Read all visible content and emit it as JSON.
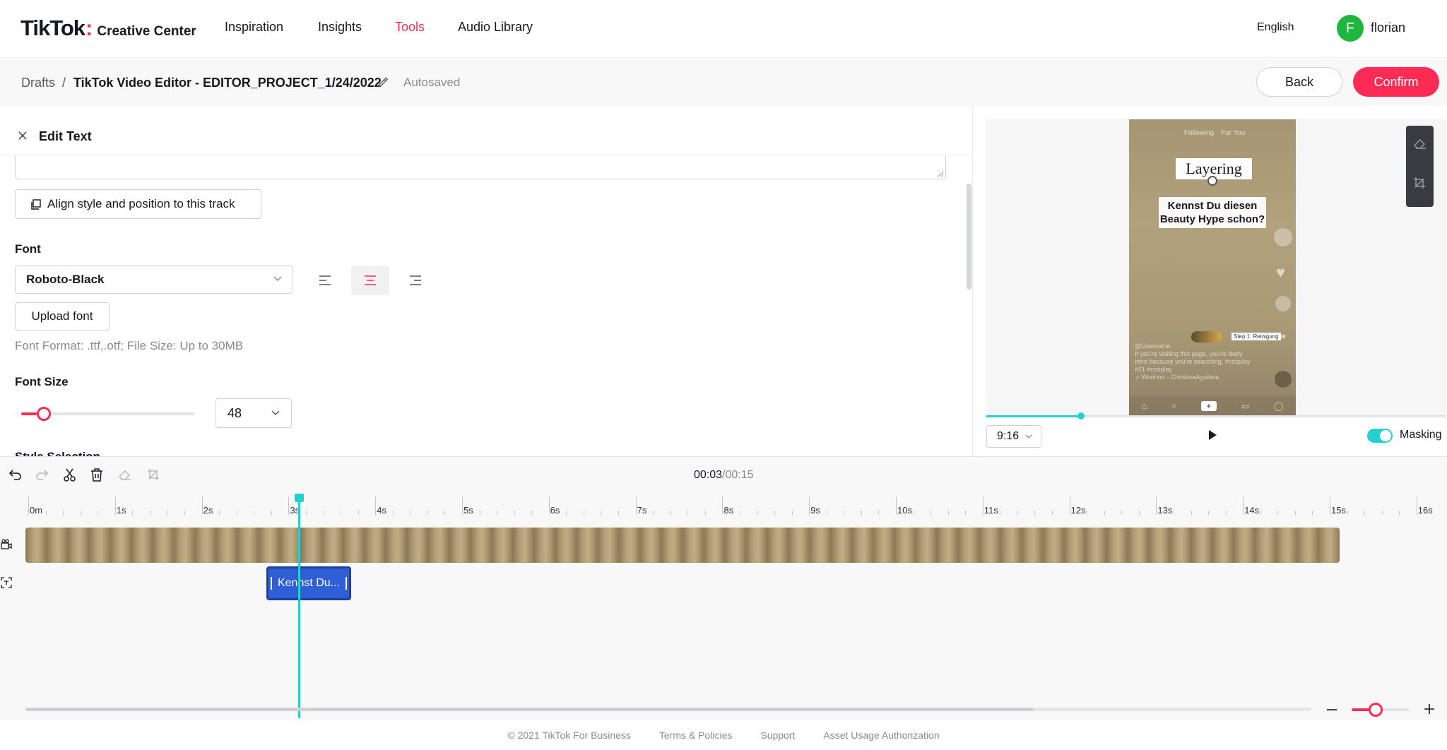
{
  "nav": {
    "logo_main": "TikTok",
    "logo_colon": ":",
    "logo_sub": "Creative Center",
    "links": [
      "Inspiration",
      "Insights",
      "Tools",
      "Audio Library"
    ],
    "active_link": "Tools",
    "language": "English",
    "avatar_initial": "F",
    "username": "florian"
  },
  "subbar": {
    "crumb_root": "Drafts",
    "separator": "/",
    "project_title": "TikTok Video Editor - EDITOR_PROJECT_1/24/2022",
    "status": "Autosaved",
    "back_label": "Back",
    "confirm_label": "Confirm"
  },
  "editor": {
    "panel_title": "Edit Text",
    "align_track_label": "Align style and position to this track",
    "font_label": "Font",
    "font_value": "Roboto-Black",
    "text_align_selected": "center",
    "upload_font_label": "Upload font",
    "font_hint": "Font Format: .ttf,.otf;  File Size: Up to 30MB",
    "font_size_label": "Font Size",
    "font_size_value": "48",
    "font_size_slider_fraction": 0.09,
    "cut_off_label": "Style Selection"
  },
  "preview": {
    "phone_tab_following": "Following",
    "phone_tab_foryou": "For You",
    "title_overlay": "Layering",
    "text_overlay_line1": "Kennst Du diesen",
    "text_overlay_line2": "Beauty Hype schon?",
    "step_overlay": "Step 1: Reinigung",
    "caption_user": "@Username",
    "caption_text": "If you're visiting this page, you're likely here because you're searching. #cosplay #21 #cosplay",
    "caption_music": "♫ Woohoo - ChristinaAguilera",
    "aspect_ratio": "9:16",
    "masking_label": "Masking",
    "masking_on": true,
    "progress_fraction": 0.2
  },
  "timeline": {
    "time_current": "00:03",
    "time_separator": "/",
    "time_total": "00:15",
    "ruler_labels": [
      "0m",
      "1s",
      "2s",
      "3s",
      "4s",
      "5s",
      "6s",
      "7s",
      "8s",
      "9s",
      "10s",
      "11s",
      "12s",
      "13s",
      "14s",
      "15s",
      "16s"
    ],
    "text_clip_label": "Kennst Du...",
    "playhead_seconds": 3.1,
    "zoom_fraction": 0.35
  },
  "footer": {
    "copyright": "© 2021 TikTok For Business",
    "terms": "Terms & Policies",
    "support": "Support",
    "asset": "Asset Usage Authorization"
  },
  "colors": {
    "brand": "#fe2c55",
    "accent_cyan": "#25d0d0",
    "clip_blue": "#2f5fd6",
    "avatar_green": "#1fb63d"
  }
}
